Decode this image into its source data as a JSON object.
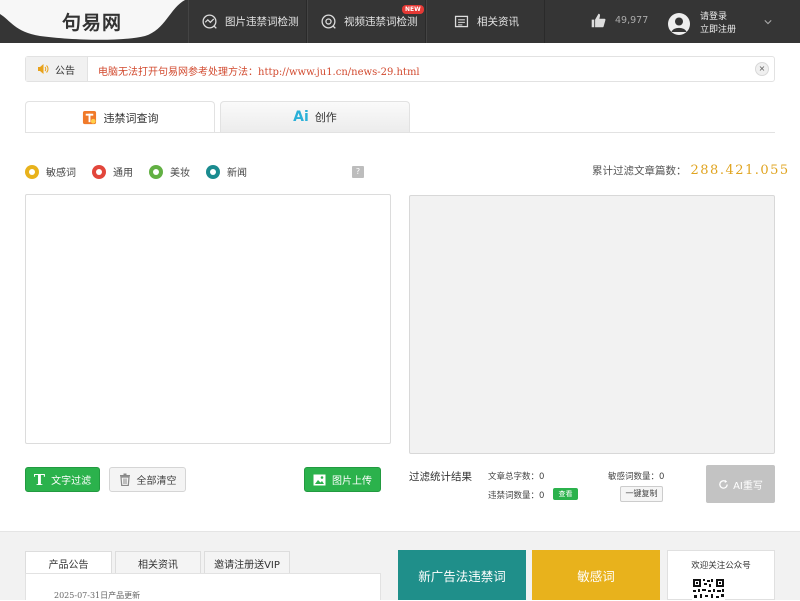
{
  "header": {
    "logo_text": "句易网",
    "nav": [
      {
        "label": "图片违禁词检测",
        "icon": "image-scan-icon"
      },
      {
        "label": "视频违禁词检测",
        "icon": "video-scan-icon",
        "badge": "NEW"
      },
      {
        "label": "相关资讯",
        "icon": "news-icon"
      }
    ],
    "likes": "49,977",
    "login_label": "请登录",
    "register_label": "立即注册"
  },
  "notice": {
    "tag": "公告",
    "text": "电脑无法打开句易网参考处理方法：http://www.ju1.cn/news-29.html",
    "close": "×"
  },
  "tabs": [
    {
      "label": "违禁词查询",
      "active": true
    },
    {
      "label": "创作",
      "icon_text": "Ai",
      "active": false
    }
  ],
  "categories": [
    {
      "label": "敏感词",
      "color": "#e8b21c"
    },
    {
      "label": "通用",
      "color": "#e2463b"
    },
    {
      "label": "美妆",
      "color": "#62b043"
    },
    {
      "label": "新闻",
      "color": "#1a8b8f"
    }
  ],
  "help_label": "?",
  "stats": {
    "total_label": "累计过滤文章篇数：",
    "total_value": "288.421.055"
  },
  "actions": {
    "filter_label": "文字过滤",
    "clear_label": "全部清空",
    "upload_label": "图片上传"
  },
  "results": {
    "title": "过滤统计结果",
    "word_count": "文章总字数：0",
    "violation_count": "违禁词数量：0",
    "sensitive_count": "敏感词数量：0",
    "view_label": "查看",
    "copy_label": "一键复制",
    "ai_rewrite_label": "AI重写"
  },
  "bottom": {
    "tabs": [
      "产品公告",
      "相关资讯",
      "邀请注册送VIP"
    ],
    "news": [
      "2025-07-31日产品更新"
    ],
    "tile_ad": "新广告法违禁词",
    "tile_sensitive": "敏感词",
    "qr_title": "欢迎关注公众号"
  },
  "colors": {
    "topbar": "#353535",
    "accent_green": "#2bb24c",
    "notice_red": "#d24a2f",
    "count_gold": "#e0a420",
    "tile_teal": "#1f8f8a",
    "tile_yellow": "#e8b21c"
  }
}
